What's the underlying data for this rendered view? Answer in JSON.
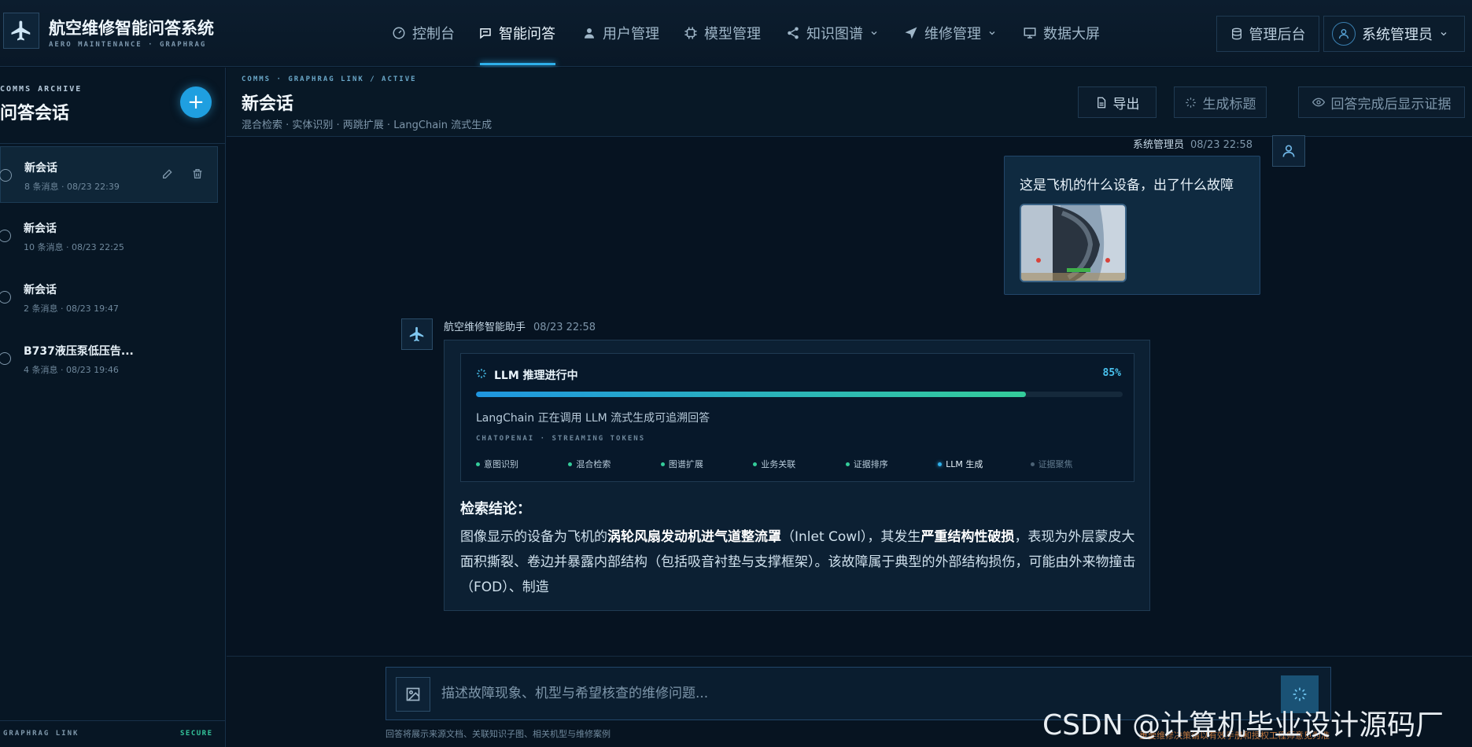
{
  "app": {
    "title": "航空维修智能问答系统",
    "subtitle": "AERO MAINTENANCE · GRAPHRAG"
  },
  "nav": {
    "items": [
      {
        "label": "控制台",
        "icon": "dashboard-icon"
      },
      {
        "label": "智能问答",
        "icon": "chat-icon",
        "active": true
      },
      {
        "label": "用户管理",
        "icon": "user-icon"
      },
      {
        "label": "模型管理",
        "icon": "chip-icon"
      },
      {
        "label": "知识图谱",
        "icon": "share-icon",
        "dropdown": true
      },
      {
        "label": "维修管理",
        "icon": "send-icon",
        "dropdown": true
      },
      {
        "label": "数据大屏",
        "icon": "monitor-icon"
      }
    ],
    "admin_label": "管理后台",
    "user_label": "系统管理员"
  },
  "sidebar": {
    "kicker": "COMMS ARCHIVE",
    "title": "问答会话",
    "new_button": "+",
    "conversations": [
      {
        "title": "新会话",
        "meta": "8 条消息 · 08/23 22:39",
        "active": true
      },
      {
        "title": "新会话",
        "meta": "10 条消息 · 08/23 22:25"
      },
      {
        "title": "新会话",
        "meta": "2 条消息 · 08/23 19:47"
      },
      {
        "title": "B737液压泵低压告...",
        "meta": "4 条消息 · 08/23 19:46"
      }
    ],
    "footer_left": "GRAPHRAG LINK",
    "footer_right": "SECURE"
  },
  "chat_header": {
    "kicker": "COMMS · GRAPHRAG LINK / ACTIVE",
    "title": "新会话",
    "subtitle": "混合检索 · 实体识别 · 两跳扩展 · LangChain 流式生成",
    "export_label": "导出",
    "gen_title_label": "生成标题",
    "evidence_label": "回答完成后显示证据"
  },
  "messages": {
    "user": {
      "sender": "系统管理员",
      "time": "08/23 22:58",
      "text": "这是飞机的什么设备，出了什么故障"
    },
    "assistant": {
      "sender": "航空维修智能助手",
      "time": "08/23 22:58",
      "llm_title": "LLM 推理进行中",
      "progress_label": "85%",
      "progress": 0.85,
      "llm_desc": "LangChain 正在调用 LLM 流式生成可追溯回答",
      "llm_kicker": "CHATOPENAI · STREAMING TOKENS",
      "steps": [
        {
          "label": "意图识别",
          "state": "done"
        },
        {
          "label": "混合检索",
          "state": "done"
        },
        {
          "label": "图谱扩展",
          "state": "done"
        },
        {
          "label": "业务关联",
          "state": "done"
        },
        {
          "label": "证据排序",
          "state": "done"
        },
        {
          "label": "LLM 生成",
          "state": "current"
        },
        {
          "label": "证据聚焦",
          "state": "pending"
        }
      ],
      "answer_title": "检索结论：",
      "answer_p1": "图像显示的设备为飞机的",
      "answer_b1": "涡轮风扇发动机进气道整流罩",
      "answer_p2": "（Inlet Cowl），其发生",
      "answer_b2": "严重结构性破损",
      "answer_p3": "，表现为外层蒙皮大面积撕裂、卷边并暴露内部结构（包括吸音衬垫与支撑框架）。该故障属于典型的外部结构损伤，可能由外来物撞击（FOD）、制造"
    }
  },
  "composer": {
    "placeholder": "描述故障现象、机型与希望核查的维修问题...",
    "hint": "回答将展示来源文档、关联知识子图、相关机型与维修案例",
    "warning": "重要维修决策请以有效手册和授权工程师意见为准"
  },
  "watermark": "CSDN @计算机毕业设计源码厂长",
  "colors": {
    "accent": "#2fb0ea",
    "success": "#34cc9a",
    "background": "#061321"
  }
}
